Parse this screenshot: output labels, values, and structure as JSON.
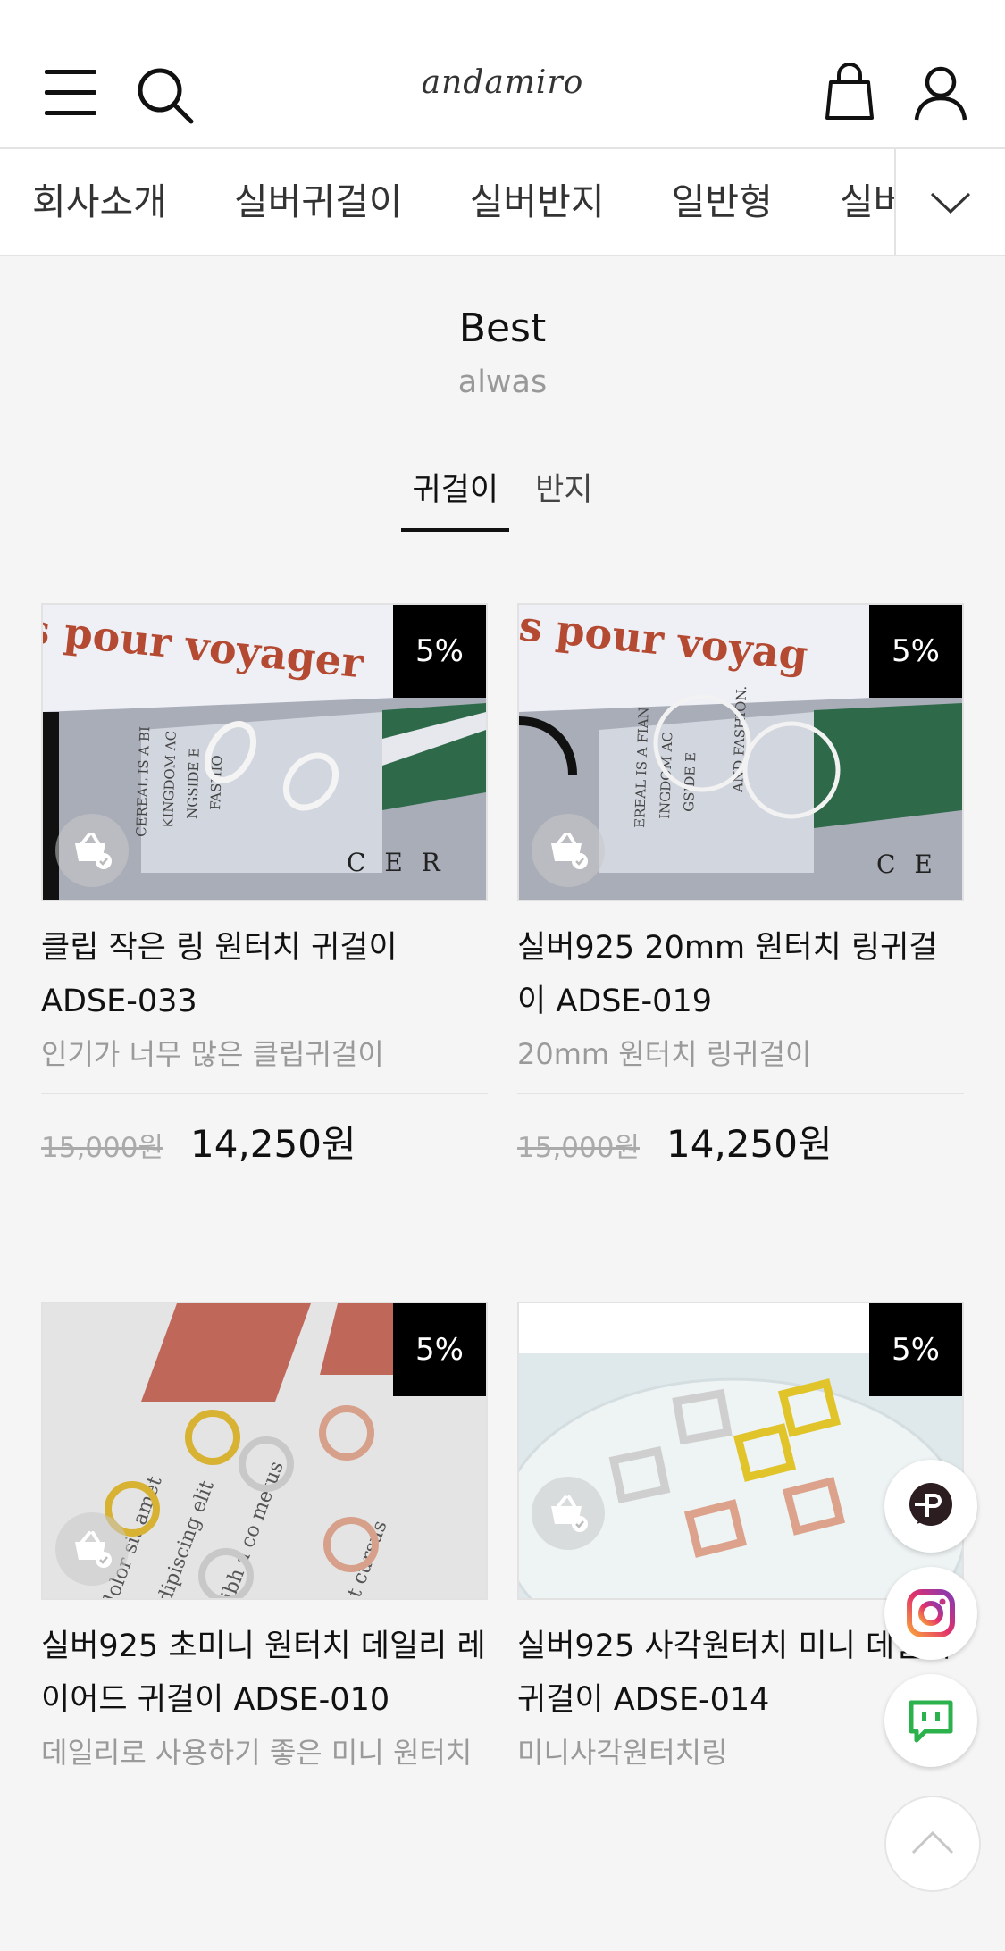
{
  "header": {
    "logo": "andamiro"
  },
  "nav": {
    "items": [
      "회사소개",
      "실버귀걸이",
      "실버반지",
      "일반형",
      "실버목"
    ]
  },
  "section": {
    "title": "Best",
    "subtitle": "alwas"
  },
  "tabs": [
    {
      "label": "귀걸이",
      "active": true
    },
    {
      "label": "반지",
      "active": false
    }
  ],
  "products": [
    {
      "badge": "5%",
      "title": "클립 작은 링 원터치 귀걸이 ADSE-033",
      "desc": "인기가 너무 많은 클립귀걸이",
      "price_old": "15,000원",
      "price_new": "14,250원",
      "image_text": [
        "s pour voyager",
        "CEREAL IS A BI",
        "KINGDOM AC",
        "NGSIDE E",
        "FASHIO",
        "C E R"
      ]
    },
    {
      "badge": "5%",
      "title": "실버925 20mm 원터치 링귀걸이 ADSE-019",
      "desc": "20mm 원터치 링귀걸이",
      "price_old": "15,000원",
      "price_new": "14,250원",
      "image_text": [
        "is pour voyag",
        "EREAL IS A FIAN",
        "INGDOM AC",
        "GSIDE E",
        "AND FASHION.",
        "C E"
      ]
    },
    {
      "badge": "5%",
      "title": "실버925 초미니 원터치 데일리 레이어드 귀걸이 ADSE-010",
      "desc": "데일리로 사용하기 좋은 미니 원터치",
      "image_text": [
        "lorem ipsum dolor sit amet",
        "consectetur adipiscing elit",
        "Mauris ante nibh a co metus",
        "Integer feugiat cursus"
      ]
    },
    {
      "badge": "5%",
      "title": "실버925 사각원터치 미니 데일리 귀걸이 ADSE-014",
      "desc": "미니사각원터치링"
    }
  ],
  "colors": {
    "accent": "#000000",
    "muted": "#999999",
    "background": "#f5f5f5"
  },
  "float_icons": [
    "talk-p-icon",
    "instagram-icon",
    "chat-icon",
    "scroll-top-icon"
  ]
}
